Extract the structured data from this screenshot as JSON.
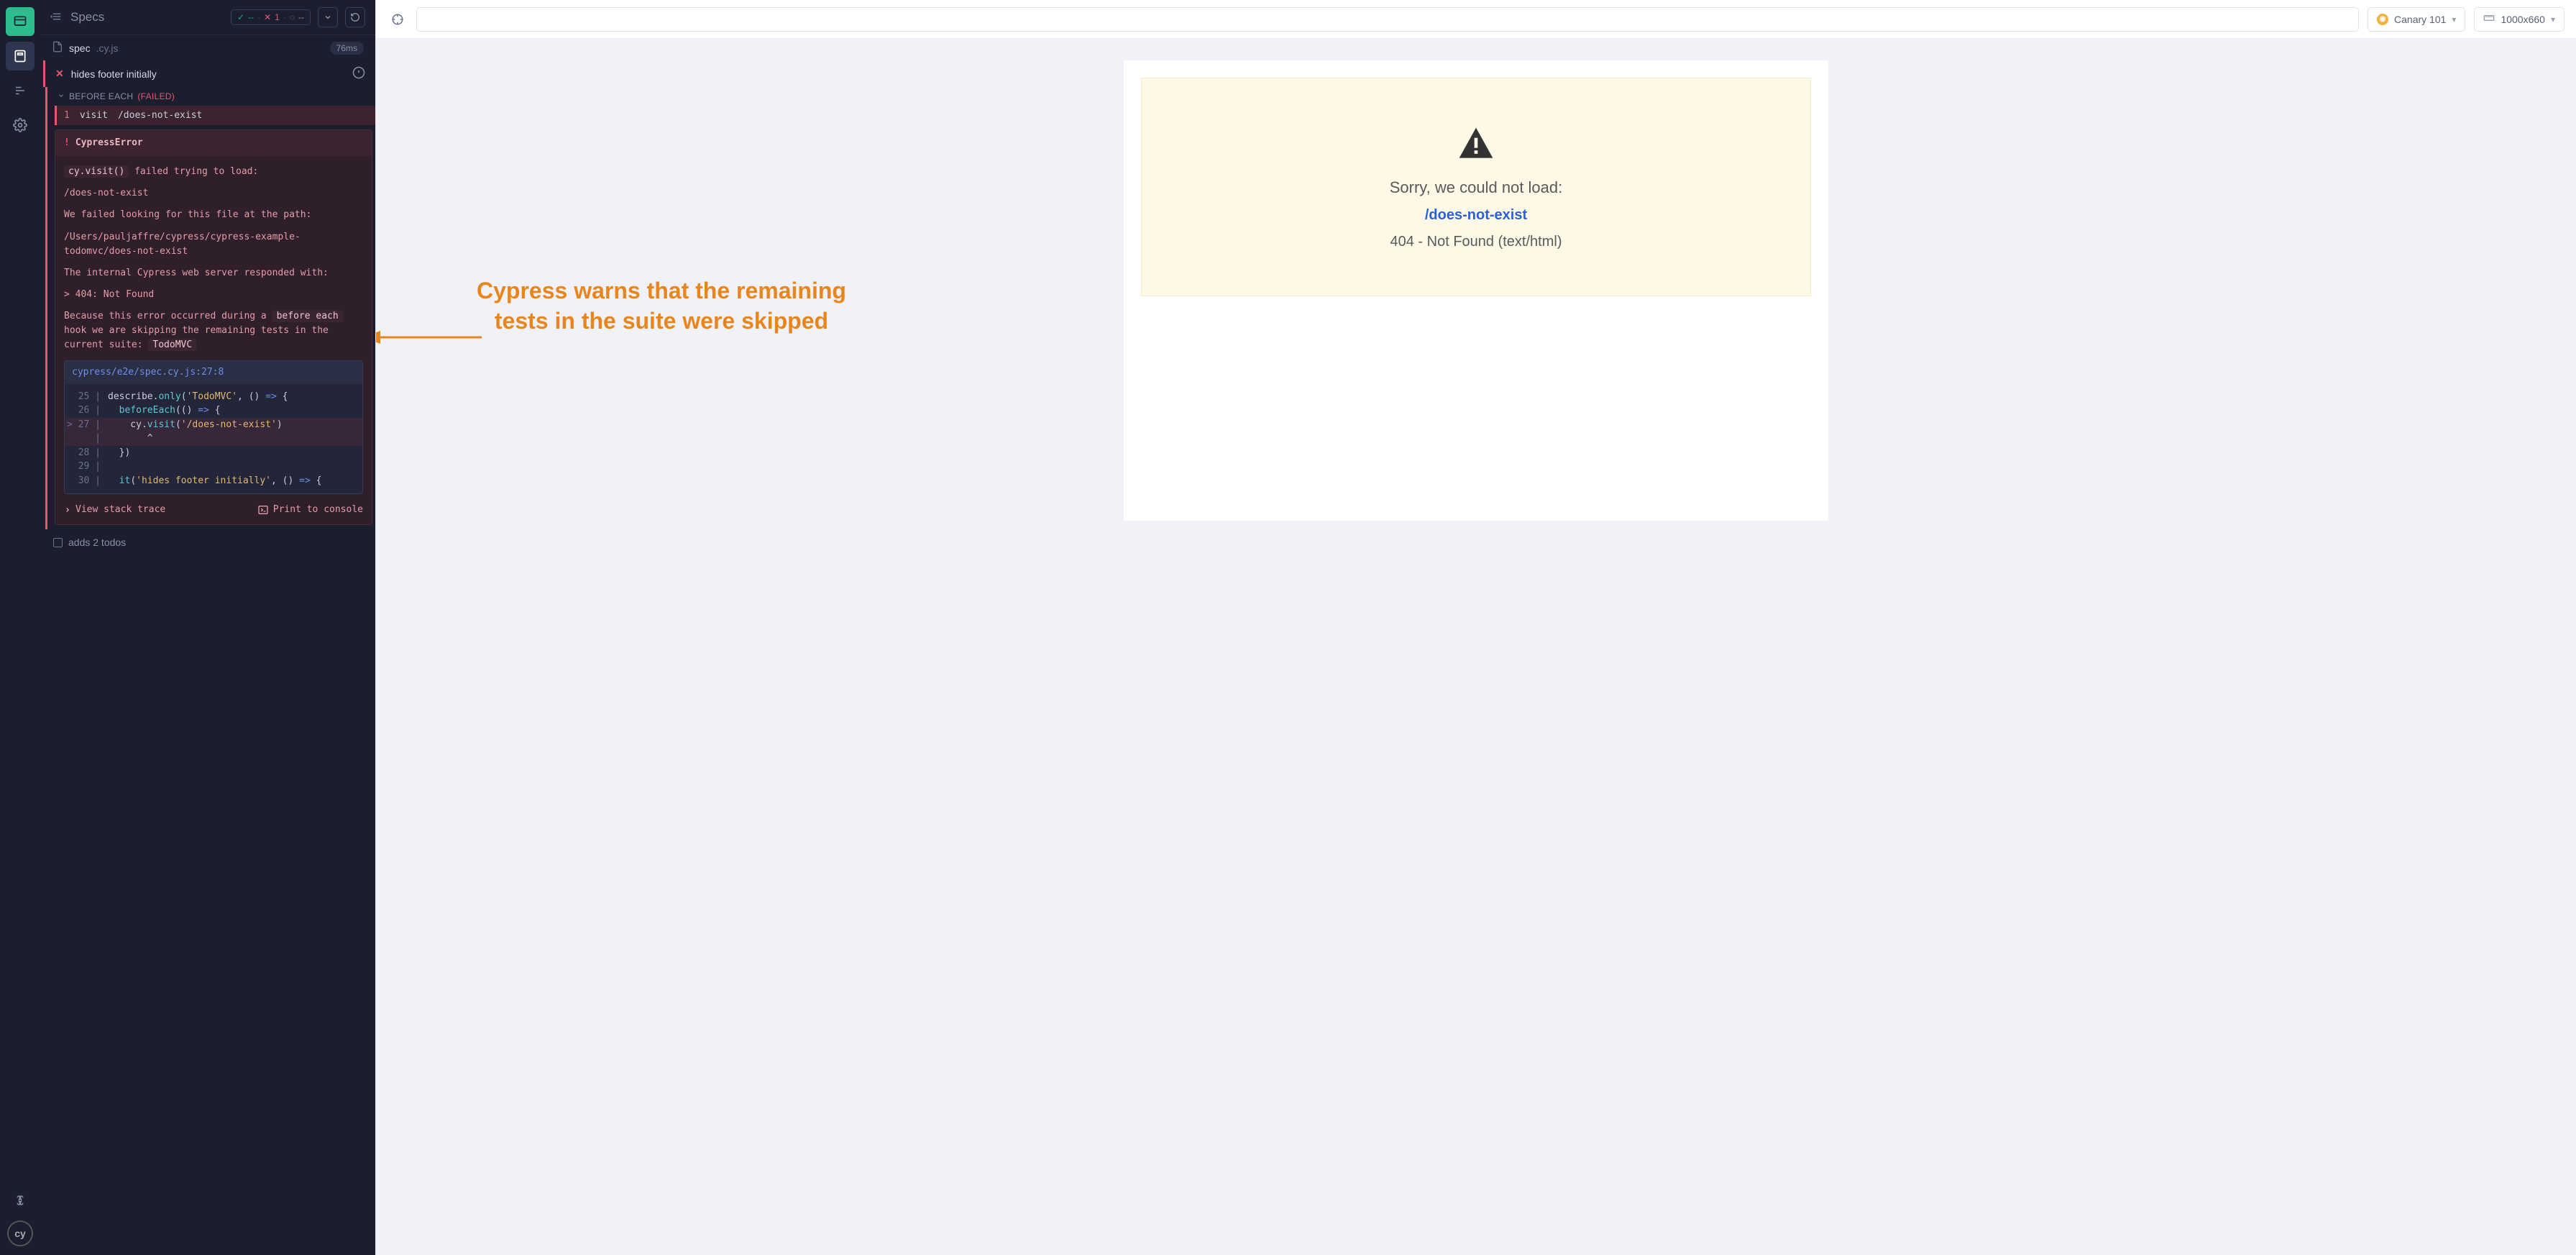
{
  "header": {
    "title": "Specs"
  },
  "stats": {
    "pass": "--",
    "fail": "1",
    "skip": "--"
  },
  "spec": {
    "name": "spec",
    "ext": ".cy.js",
    "duration": "76ms"
  },
  "test": {
    "name": "hides footer initially"
  },
  "hook": {
    "label": "BEFORE EACH",
    "status": "(FAILED)"
  },
  "command": {
    "num": "1",
    "name": "visit",
    "arg": "/does-not-exist"
  },
  "error": {
    "title": "CypressError",
    "msg1_pre": "cy.visit()",
    "msg1_post": " failed trying to load:",
    "path": "/does-not-exist",
    "msg2": "We failed looking for this file at the path:",
    "fspath": "/Users/pauljaffre/cypress/cypress-example-todomvc/does-not-exist",
    "msg3": "The internal Cypress web server responded with:",
    "status": "> 404: Not Found",
    "msg4_a": "Because this error occurred during a ",
    "msg4_code1": "before each",
    "msg4_b": " hook we are skipping the remaining tests in the current suite: ",
    "msg4_code2": "TodoMVC"
  },
  "codeframe": {
    "header": "cypress/e2e/spec.cy.js:27:8",
    "lines": [
      {
        "gutter": "  25 |",
        "code": [
          [
            "id",
            "describe"
          ],
          [
            "punc",
            "."
          ],
          [
            "fn",
            "only"
          ],
          [
            "punc",
            "("
          ],
          [
            "str",
            "'TodoMVC'"
          ],
          [
            "punc",
            ", () "
          ],
          [
            "keyword",
            "=>"
          ],
          [
            "punc",
            " {"
          ]
        ]
      },
      {
        "gutter": "  26 |",
        "code": [
          [
            "punc",
            "  "
          ],
          [
            "fn",
            "beforeEach"
          ],
          [
            "punc",
            "(() "
          ],
          [
            "keyword",
            "=>"
          ],
          [
            "punc",
            " {"
          ]
        ]
      },
      {
        "gutter": "> 27 |",
        "hl": true,
        "code": [
          [
            "punc",
            "    cy."
          ],
          [
            "fn",
            "visit"
          ],
          [
            "punc",
            "("
          ],
          [
            "str",
            "'/does-not-exist'"
          ],
          [
            "punc",
            ")"
          ]
        ]
      },
      {
        "gutter": "     |",
        "hl": true,
        "code": [
          [
            "punc",
            "       ^"
          ]
        ]
      },
      {
        "gutter": "  28 |",
        "code": [
          [
            "punc",
            "  })"
          ]
        ]
      },
      {
        "gutter": "  29 |",
        "code": []
      },
      {
        "gutter": "  30 |",
        "code": [
          [
            "punc",
            "  "
          ],
          [
            "fn",
            "it"
          ],
          [
            "punc",
            "("
          ],
          [
            "str",
            "'hides footer initially'"
          ],
          [
            "punc",
            ", () "
          ],
          [
            "keyword",
            "=>"
          ],
          [
            "punc",
            " {"
          ]
        ]
      }
    ]
  },
  "errActions": {
    "stack": "View stack trace",
    "print": "Print to console"
  },
  "skippedTest": {
    "name": "adds 2 todos"
  },
  "aut": {
    "browser": "Canary 101",
    "viewport": "1000x660",
    "warn": {
      "line1": "Sorry, we could not load:",
      "line2": "/does-not-exist",
      "line3": "404 - Not Found (text/html)"
    }
  },
  "annotation": {
    "line1": "Cypress warns that the remaining",
    "line2": "tests in the suite were skipped"
  }
}
